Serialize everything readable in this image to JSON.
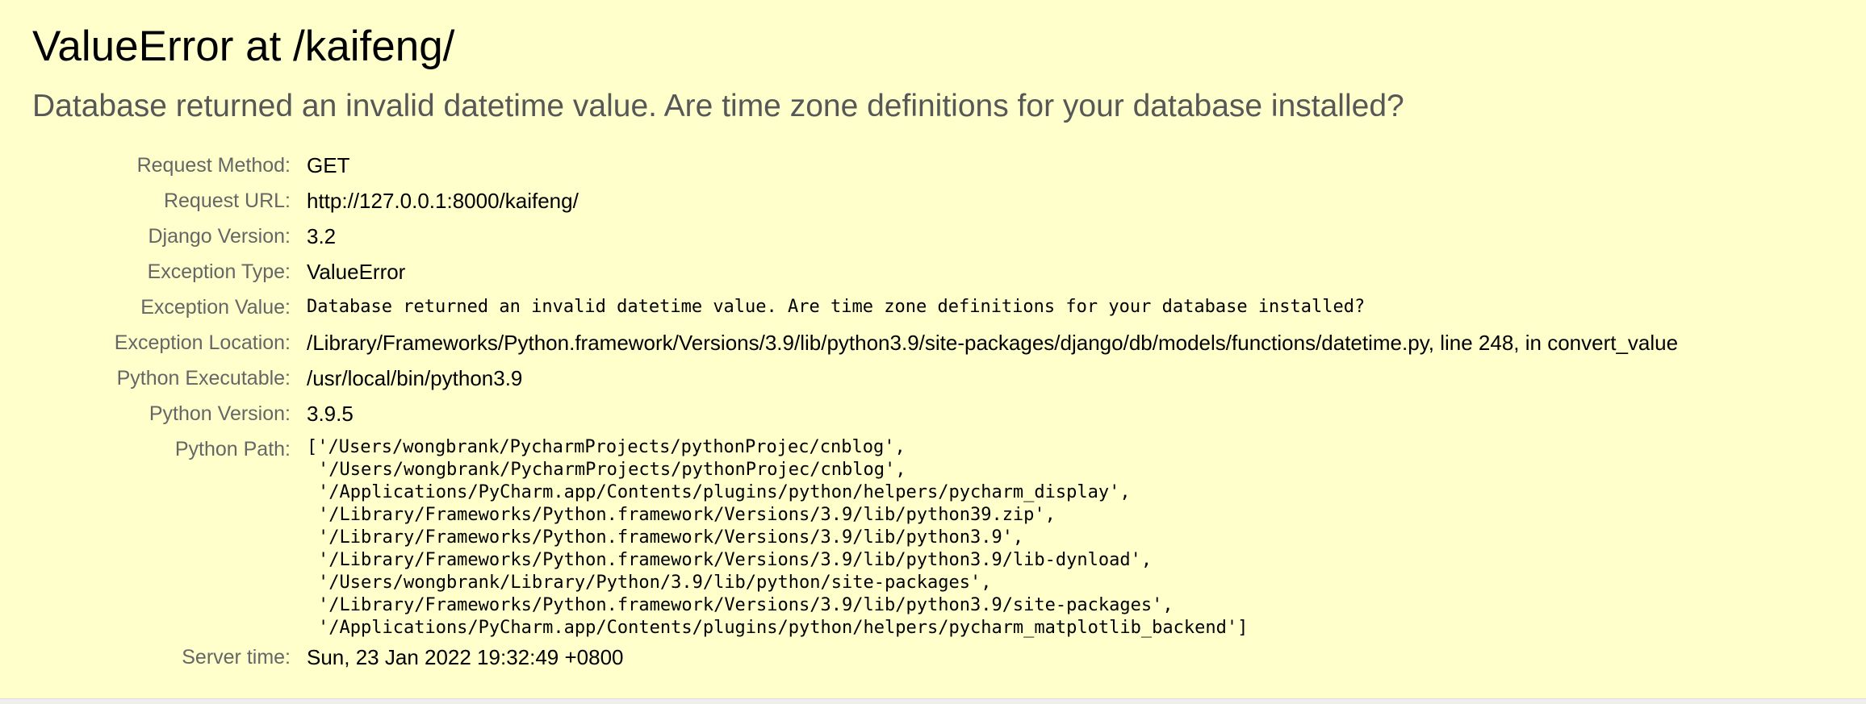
{
  "title": "ValueError at /kaifeng/",
  "subtitle": "Database returned an invalid datetime value. Are time zone definitions for your database installed?",
  "meta": {
    "request_method_label": "Request Method:",
    "request_method": "GET",
    "request_url_label": "Request URL:",
    "request_url": "http://127.0.0.1:8000/kaifeng/",
    "django_version_label": "Django Version:",
    "django_version": "3.2",
    "exception_type_label": "Exception Type:",
    "exception_type": "ValueError",
    "exception_value_label": "Exception Value:",
    "exception_value": "Database returned an invalid datetime value. Are time zone definitions for your database installed?",
    "exception_location_label": "Exception Location:",
    "exception_location": "/Library/Frameworks/Python.framework/Versions/3.9/lib/python3.9/site-packages/django/db/models/functions/datetime.py, line 248, in convert_value",
    "python_executable_label": "Python Executable:",
    "python_executable": "/usr/local/bin/python3.9",
    "python_version_label": "Python Version:",
    "python_version": "3.9.5",
    "python_path_label": "Python Path:",
    "python_path": [
      "['/Users/wongbrank/PycharmProjects/pythonProjec/cnblog',",
      "'/Users/wongbrank/PycharmProjects/pythonProjec/cnblog',",
      "'/Applications/PyCharm.app/Contents/plugins/python/helpers/pycharm_display',",
      "'/Library/Frameworks/Python.framework/Versions/3.9/lib/python39.zip',",
      "'/Library/Frameworks/Python.framework/Versions/3.9/lib/python3.9',",
      "'/Library/Frameworks/Python.framework/Versions/3.9/lib/python3.9/lib-dynload',",
      "'/Users/wongbrank/Library/Python/3.9/lib/python/site-packages',",
      "'/Library/Frameworks/Python.framework/Versions/3.9/lib/python3.9/site-packages',",
      "'/Applications/PyCharm.app/Contents/plugins/python/helpers/pycharm_matplotlib_backend']"
    ],
    "server_time_label": "Server time:",
    "server_time": "Sun, 23 Jan 2022 19:32:49 +0800"
  },
  "colors": {
    "background": "#ffffcc",
    "label": "#666666",
    "subtitle": "#575757"
  }
}
